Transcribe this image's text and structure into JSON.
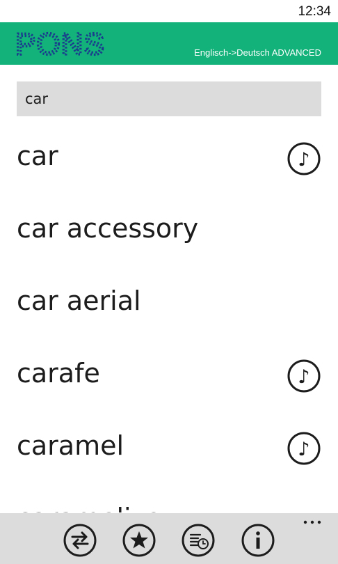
{
  "status_bar": {
    "time": "12:34"
  },
  "header": {
    "logo": "PONS",
    "direction": "Englisch->Deutsch ADVANCED",
    "background_color": "#12b27a",
    "logo_color": "#1a3d8c"
  },
  "search": {
    "value": "car"
  },
  "results": [
    {
      "word": "car",
      "audio": true
    },
    {
      "word": "car accessory",
      "audio": false
    },
    {
      "word": "car aerial",
      "audio": false
    },
    {
      "word": "carafe",
      "audio": true
    },
    {
      "word": "caramel",
      "audio": true
    },
    {
      "word": "caramelize",
      "audio": false
    }
  ],
  "app_bar": {
    "buttons": [
      {
        "icon": "swap-direction-icon"
      },
      {
        "icon": "star-favorites-icon"
      },
      {
        "icon": "history-icon"
      },
      {
        "icon": "info-icon"
      }
    ],
    "more_icon": "more-dots-icon"
  }
}
